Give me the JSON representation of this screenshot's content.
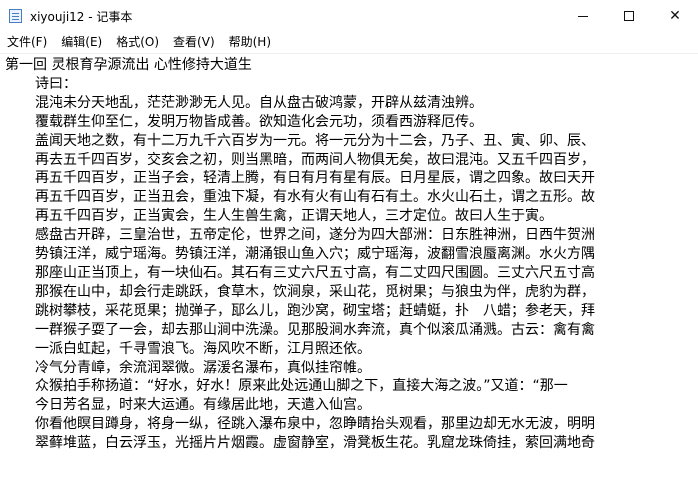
{
  "window": {
    "title": "xiyouji12 - 记事本"
  },
  "menu": {
    "items": [
      "文件(F)",
      "编辑(E)",
      "格式(O)",
      "查看(V)",
      "帮助(H)"
    ]
  },
  "editor": {
    "lines": [
      "第一回 灵根育孕源流出 心性修持大道生",
      "诗曰：",
      "混沌未分天地乱，茫茫渺渺无人见。自从盘古破鸿蒙，开辟从兹清浊辨。",
      "覆载群生仰至仁，发明万物皆成善。欲知造化会元功，须看西游释厄传。",
      "盖闻天地之数，有十二万九千六百岁为一元。将一元分为十二会，乃子、丑、寅、卯、辰、",
      "再去五千四百岁，交亥会之初，则当黑暗，而两间人物俱无矣，故曰混沌。又五千四百岁，",
      "再五千四百岁，正当子会，轻清上腾，有日有月有星有辰。日月星辰，谓之四象。故曰天开",
      "再五千四百岁，正当丑会，重浊下凝，有水有火有山有石有土。水火山石土，谓之五形。故",
      "再五千四百岁，正当寅会，生人生兽生禽，正谓天地人，三才定位。故曰人生于寅。",
      "感盘古开辟，三皇治世，五帝定伦，世界之间，遂分为四大部洲：日东胜神洲，日西牛贺洲",
      "势镇汪洋，威宁瑶海。势镇汪洋，潮涌银山鱼入穴；威宁瑶海，波翻雪浪蜃离渊。水火方隅",
      "那座山正当顶上，有一块仙石。其石有三丈六尺五寸高，有二丈四尺围圆。三丈六尺五寸高",
      "那猴在山中，却会行走跳跃，食草木，饮涧泉，采山花，觅树果；与狼虫为伴，虎豹为群，",
      "跳树攀枝，采花觅果；抛弹子，邷么儿，跑沙窝，砌宝塔；赶蜻蜓，扑　八蜡；参老天，拜",
      "一群猴子耍了一会，却去那山涧中洗澡。见那股涧水奔流，真个似滚瓜涌溅。古云：禽有禽",
      "一派白虹起，千寻雪浪飞。海风吹不断，江月照还依。",
      "冷气分青嶂，余流润翠微。潺湲名瀑布，真似挂帘帷。",
      "众猴拍手称扬道：“好水，好水！原来此处远通山脚之下，直接大海之波。”又道：“那一",
      "今日芳名显，时来大运通。有缘居此地，天遣入仙宫。",
      "你看他瞑目蹲身，将身一纵，径跳入瀑布泉中，忽睁睛抬头观看，那里边却无水无波，明明",
      "翠藓堆蓝，白云浮玉，光摇片片烟霞。虚窗静室，滑凳板生花。乳窟龙珠倚挂，萦回满地奇"
    ]
  }
}
